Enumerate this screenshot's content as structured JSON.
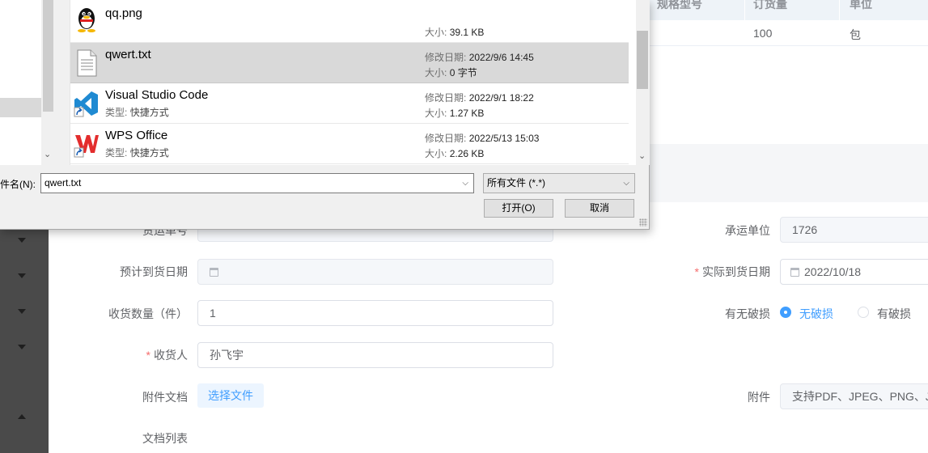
{
  "background_table": {
    "headers": [
      "规格型号",
      "订货量",
      "单位"
    ],
    "row": [
      "",
      "100",
      "包"
    ]
  },
  "form": {
    "tracking_no_label": "货运单号",
    "carrier_label": "承运单位",
    "carrier_value": "1726",
    "expected_date_label": "预计到货日期",
    "actual_date_label": "实际到货日期",
    "actual_date_value": "2022/10/18",
    "received_qty_label": "收货数量（件）",
    "received_qty_value": "1",
    "damage_label": "有无破损",
    "damage_options": [
      "无破损",
      "有破损"
    ],
    "receiver_label": "收货人",
    "receiver_value": "孙飞宇",
    "attachment_doc_label": "附件文档",
    "choose_file_label": "选择文件",
    "attachment_label": "附件",
    "attachment_placeholder": "支持PDF、JPEG、PNG、JP",
    "doc_list_label": "文档列表",
    "required_mark": "*"
  },
  "dialog": {
    "files": [
      {
        "name": "qq.png",
        "type_label": "",
        "type": "",
        "date_label": "",
        "date": "",
        "size_label": "大小:",
        "size": "39.1 KB",
        "icon": "qq-penguin-icon"
      },
      {
        "name": "qwert.txt",
        "type_label": "",
        "type": "",
        "date_label": "修改日期:",
        "date": "2022/9/6 14:45",
        "size_label": "大小:",
        "size": "0 字节",
        "icon": "text-file-icon"
      },
      {
        "name": "Visual Studio Code",
        "type_label": "类型:",
        "type": "快捷方式",
        "date_label": "修改日期:",
        "date": "2022/9/1 18:22",
        "size_label": "大小:",
        "size": "1.27 KB",
        "icon": "vscode-icon"
      },
      {
        "name": "WPS Office",
        "type_label": "类型:",
        "type": "快捷方式",
        "date_label": "修改日期:",
        "date": "2022/5/13 15:03",
        "size_label": "大小:",
        "size": "2.26 KB",
        "icon": "wps-icon"
      }
    ],
    "filename_label": "件名(N):",
    "filename_value": "qwert.txt",
    "filter_value": "所有文件 (*.*)",
    "open_button": "打开(O)",
    "cancel_button": "取消"
  },
  "colors": {
    "accent": "#409eff",
    "required": "#f56c6c",
    "selected_row": "#d9d9d9"
  }
}
